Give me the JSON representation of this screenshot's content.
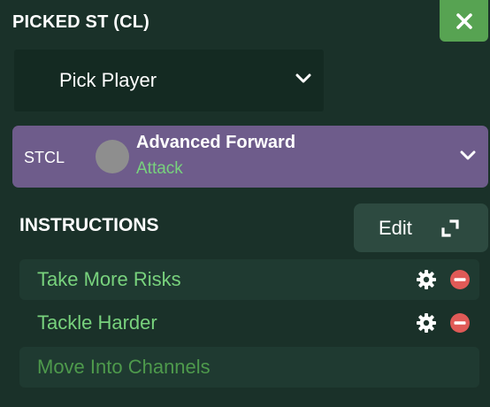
{
  "header": {
    "title": "PICKED ST (CL)"
  },
  "close_button": {
    "icon": "close-icon"
  },
  "player_select": {
    "value": "Pick Player",
    "icon": "chevron-down-icon"
  },
  "role": {
    "position": "STCL",
    "name": "Advanced Forward",
    "duty": "Attack",
    "icon": "chevron-down-icon",
    "color": "#6e5c8b",
    "duty_color": "#78d27d"
  },
  "instructions": {
    "title": "INSTRUCTIONS",
    "edit_label": "Edit",
    "edit_icon": "expand-icon",
    "items": [
      {
        "label": "Take More Risks",
        "has_controls": true
      },
      {
        "label": "Tackle Harder",
        "has_controls": true
      },
      {
        "label": "Move Into Channels",
        "has_controls": false
      }
    ]
  },
  "colors": {
    "background": "#1a3129",
    "accent_green": "#57a352",
    "remove_red": "#e05a57"
  }
}
